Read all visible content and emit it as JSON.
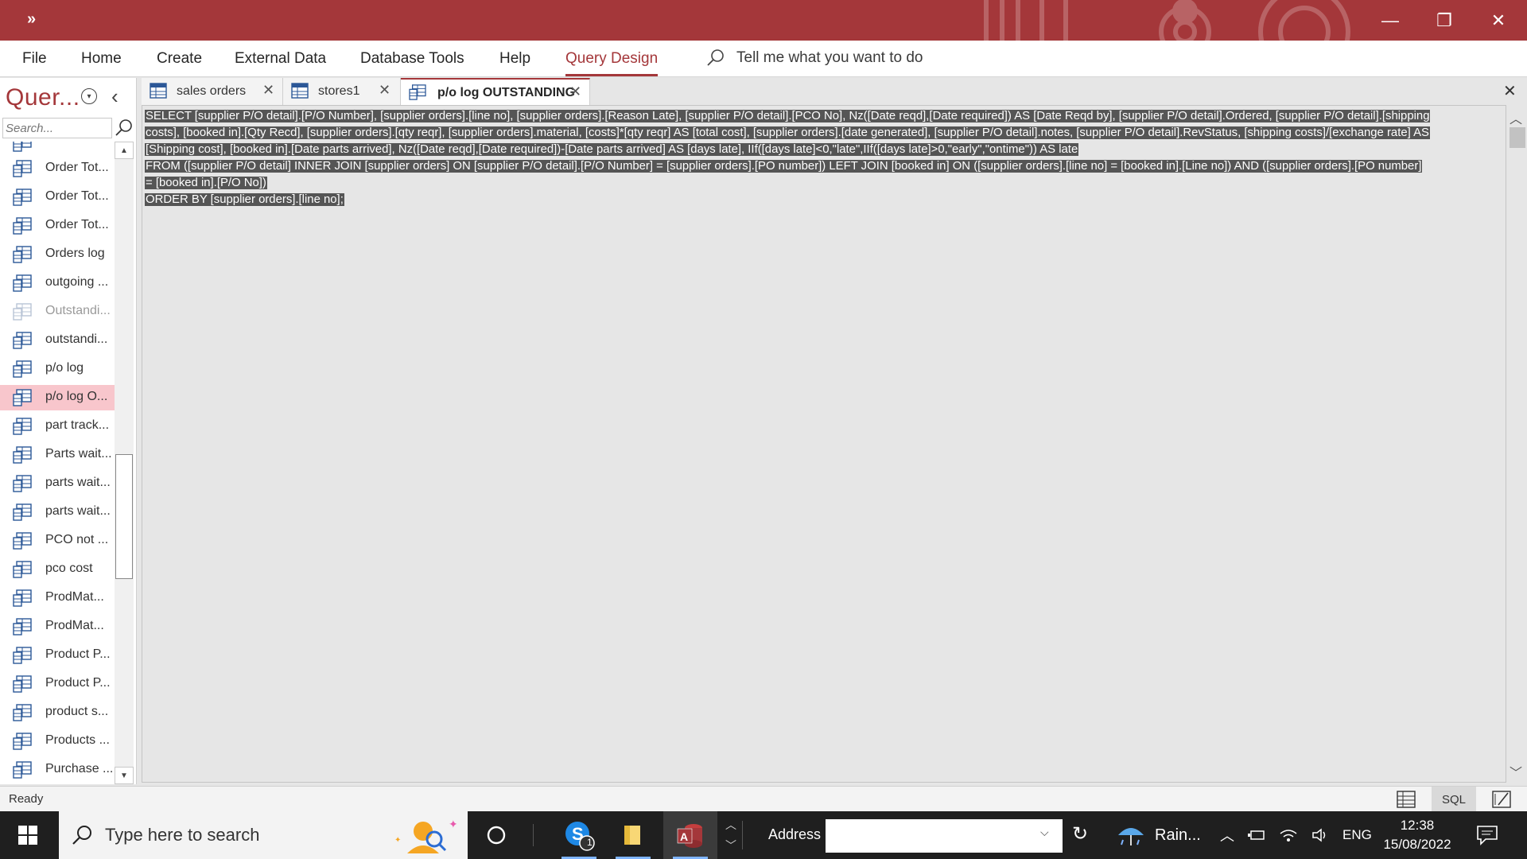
{
  "title_bar": {
    "qat_label": "»",
    "minimize": "—",
    "restore": "❐",
    "close": "✕"
  },
  "menu": {
    "items": [
      "File",
      "Home",
      "Create",
      "External Data",
      "Database Tools",
      "Help",
      "Query Design"
    ],
    "active_index": 6,
    "tell_me": "Tell me what you want to do"
  },
  "nav": {
    "title": "Quer...",
    "search_placeholder": "Search...",
    "items": [
      {
        "label": "Order Tot...",
        "selected": false,
        "dim": false
      },
      {
        "label": "Order Tot...",
        "selected": false,
        "dim": false
      },
      {
        "label": "Order Tot...",
        "selected": false,
        "dim": false
      },
      {
        "label": "Orders log",
        "selected": false,
        "dim": false
      },
      {
        "label": "outgoing ...",
        "selected": false,
        "dim": false
      },
      {
        "label": "Outstandi...",
        "selected": false,
        "dim": true
      },
      {
        "label": "outstandi...",
        "selected": false,
        "dim": false
      },
      {
        "label": "p/o log",
        "selected": false,
        "dim": false
      },
      {
        "label": "p/o log O...",
        "selected": true,
        "dim": false
      },
      {
        "label": "part track...",
        "selected": false,
        "dim": false
      },
      {
        "label": "Parts wait...",
        "selected": false,
        "dim": false
      },
      {
        "label": "parts wait...",
        "selected": false,
        "dim": false
      },
      {
        "label": "parts wait...",
        "selected": false,
        "dim": false
      },
      {
        "label": "PCO  not ...",
        "selected": false,
        "dim": false
      },
      {
        "label": "pco cost",
        "selected": false,
        "dim": false
      },
      {
        "label": "ProdMat...",
        "selected": false,
        "dim": false
      },
      {
        "label": "ProdMat...",
        "selected": false,
        "dim": false
      },
      {
        "label": "Product P...",
        "selected": false,
        "dim": false
      },
      {
        "label": "Product P...",
        "selected": false,
        "dim": false
      },
      {
        "label": "product s...",
        "selected": false,
        "dim": false
      },
      {
        "label": "Products ...",
        "selected": false,
        "dim": false
      },
      {
        "label": "Purchase ...",
        "selected": false,
        "dim": false
      }
    ]
  },
  "tabs": [
    {
      "label": "sales orders",
      "active": false,
      "icon": "table-icon"
    },
    {
      "label": "stores1",
      "active": false,
      "icon": "table-icon"
    },
    {
      "label": "p/o log OUTSTANDING",
      "active": true,
      "icon": "query-icon"
    }
  ],
  "sql": [
    "SELECT [supplier P/O detail].[P/O Number], [supplier orders].[line no], [supplier orders].[Reason Late], [supplier P/O detail].[PCO No], Nz([Date reqd],[Date required]) AS [Date Reqd by], [supplier P/O detail].Ordered, [supplier P/O detail].[shipping",
    "costs], [booked in].[Qty Recd], [supplier orders].[qty reqr], [supplier orders].material, [costs]*[qty reqr] AS [total cost], [supplier orders].[date generated], [supplier P/O detail].notes, [supplier P/O detail].RevStatus, [shipping costs]/[exchange rate] AS",
    "[Shipping cost], [booked in].[Date parts arrived], Nz([Date reqd],[Date required])-[Date parts arrived] AS [days late], IIf([days late]<0,\"late\",IIf([days late]>0,\"early\",\"ontime\")) AS late",
    "FROM ([supplier P/O detail] INNER JOIN [supplier orders] ON [supplier P/O detail].[P/O Number] = [supplier orders].[PO number]) LEFT JOIN [booked in] ON ([supplier orders].[line no] = [booked in].[Line no]) AND ([supplier orders].[PO number]",
    "= [booked in].[P/O No])",
    "ORDER BY [supplier orders].[line no];"
  ],
  "status": {
    "text": "Ready",
    "views": [
      "datasheet-view",
      "SQL",
      "design-view"
    ]
  },
  "taskbar": {
    "search_text": "Type here to search",
    "skype_badge": "1",
    "address_label": "Address",
    "weather": "Rain...",
    "language": "ENG",
    "time": "12:38",
    "date": "15/08/2022"
  },
  "colors": {
    "accent": "#a4373a",
    "selection": "#555555",
    "nav_selected": "#f8c6cc",
    "taskbar": "#1f1f1f"
  }
}
